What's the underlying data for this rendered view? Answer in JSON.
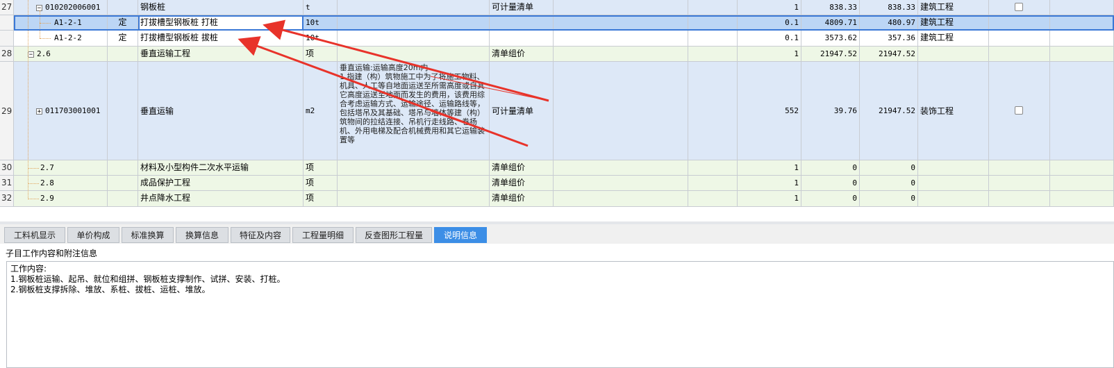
{
  "rows": [
    {
      "num": "27",
      "code": "010202006001",
      "type": "",
      "name": "钢板桩",
      "unit": "t",
      "feature": "",
      "category": "可计量清单",
      "qty": "1",
      "price": "838.33",
      "total": "838.33",
      "major": "建筑工程",
      "checkbox": true
    },
    {
      "num": "",
      "code": "A1-2-1",
      "type": "定",
      "name": "打拔槽型钢板桩 打桩",
      "unit": "10t",
      "feature": "",
      "category": "",
      "qty": "0.1",
      "price": "4809.71",
      "total": "480.97",
      "major": "建筑工程",
      "checkbox": false
    },
    {
      "num": "",
      "code": "A1-2-2",
      "type": "定",
      "name": "打拔槽型钢板桩 拔桩",
      "unit": "10t",
      "feature": "",
      "category": "",
      "qty": "0.1",
      "price": "3573.62",
      "total": "357.36",
      "major": "建筑工程",
      "checkbox": false
    },
    {
      "num": "28",
      "code": "2.6",
      "type": "",
      "name": "垂直运输工程",
      "unit": "项",
      "feature": "",
      "category": "清单组价",
      "qty": "1",
      "price": "21947.52",
      "total": "21947.52",
      "major": "",
      "checkbox": false
    },
    {
      "num": "29",
      "code": "011703001001",
      "type": "",
      "name": "垂直运输",
      "unit": "m2",
      "feature": "垂直运输:运输高度20m内\n1.指建（构）筑物施工中为了将施工物料、机具、人工等自地面运送至所需高度或自其它高度运送至地面而发生的费用，该费用综合考虑运输方式、运输途径、运输路线等，包括塔吊及其基础、塔吊与墙体等建（构）筑物间的拉结连接、吊机行走线路、卷扬机、外用电梯及配合机械费用和其它运输装置等",
      "category": "可计量清单",
      "qty": "552",
      "price": "39.76",
      "total": "21947.52",
      "major": "装饰工程",
      "checkbox": true
    },
    {
      "num": "30",
      "code": "2.7",
      "type": "",
      "name": "材料及小型构件二次水平运输",
      "unit": "项",
      "feature": "",
      "category": "清单组价",
      "qty": "1",
      "price": "0",
      "total": "0",
      "major": "",
      "checkbox": false
    },
    {
      "num": "31",
      "code": "2.8",
      "type": "",
      "name": "成品保护工程",
      "unit": "项",
      "feature": "",
      "category": "清单组价",
      "qty": "1",
      "price": "0",
      "total": "0",
      "major": "",
      "checkbox": false
    },
    {
      "num": "32",
      "code": "2.9",
      "type": "",
      "name": "井点降水工程",
      "unit": "项",
      "feature": "",
      "category": "清单组价",
      "qty": "1",
      "price": "0",
      "total": "0",
      "major": "",
      "checkbox": false
    }
  ],
  "tabs": [
    "工料机显示",
    "单价构成",
    "标准换算",
    "换算信息",
    "特征及内容",
    "工程量明细",
    "反查图形工程量",
    "说明信息"
  ],
  "active_tab": "说明信息",
  "panel": {
    "title": "子目工作内容和附注信息",
    "lines": [
      "工作内容:",
      "1.钢板桩运输、起吊、就位和组拼、钢板桩支撑制作、试拼、安装、打桩。",
      "2.钢板桩支撑拆除、堆放、系桩、拔桩、运桩、堆放。"
    ]
  },
  "colors": {
    "accent": "#3c8ee6",
    "arrow": "#e8332a",
    "row_blue": "#dde8f7",
    "row_green": "#eef7e6"
  }
}
